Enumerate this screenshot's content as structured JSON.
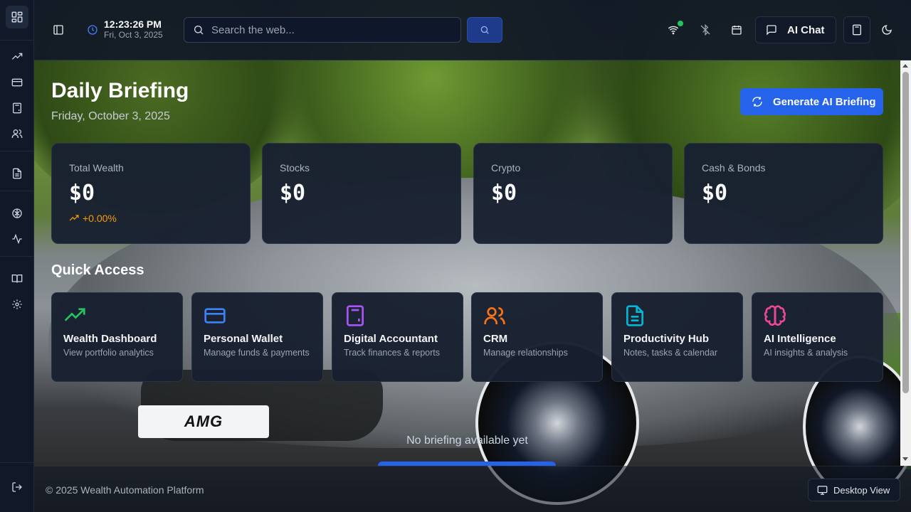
{
  "header": {
    "time": "12:23:26 PM",
    "date": "Fri, Oct 3, 2025",
    "search_placeholder": "Search the web...",
    "ai_chat_label": "AI Chat"
  },
  "page": {
    "title": "Daily Briefing",
    "subtitle": "Friday, October 3, 2025",
    "generate_label": "Generate AI Briefing",
    "empty_message": "No briefing available yet"
  },
  "stats": [
    {
      "label": "Total Wealth",
      "value": "$0",
      "change": "+0.00%"
    },
    {
      "label": "Stocks",
      "value": "$0"
    },
    {
      "label": "Crypto",
      "value": "$0"
    },
    {
      "label": "Cash & Bonds",
      "value": "$0"
    }
  ],
  "quick_access": {
    "title": "Quick Access",
    "items": [
      {
        "name": "Wealth Dashboard",
        "desc": "View portfolio analytics",
        "icon": "trending-up-icon",
        "color": "#22c55e"
      },
      {
        "name": "Personal Wallet",
        "desc": "Manage funds & payments",
        "icon": "credit-card-icon",
        "color": "#3b82f6"
      },
      {
        "name": "Digital Accountant",
        "desc": "Track finances & reports",
        "icon": "calculator-icon",
        "color": "#a855f7"
      },
      {
        "name": "CRM",
        "desc": "Manage relationships",
        "icon": "users-icon",
        "color": "#f97316"
      },
      {
        "name": "Productivity Hub",
        "desc": "Notes, tasks & calendar",
        "icon": "document-icon",
        "color": "#06b6d4"
      },
      {
        "name": "AI Intelligence",
        "desc": "AI insights & analysis",
        "icon": "brain-icon",
        "color": "#ec4899"
      }
    ]
  },
  "footer": {
    "copyright": "© 2025 Wealth Automation Platform",
    "view_mode": "Desktop View"
  },
  "background": {
    "plate_text": "AMG"
  }
}
